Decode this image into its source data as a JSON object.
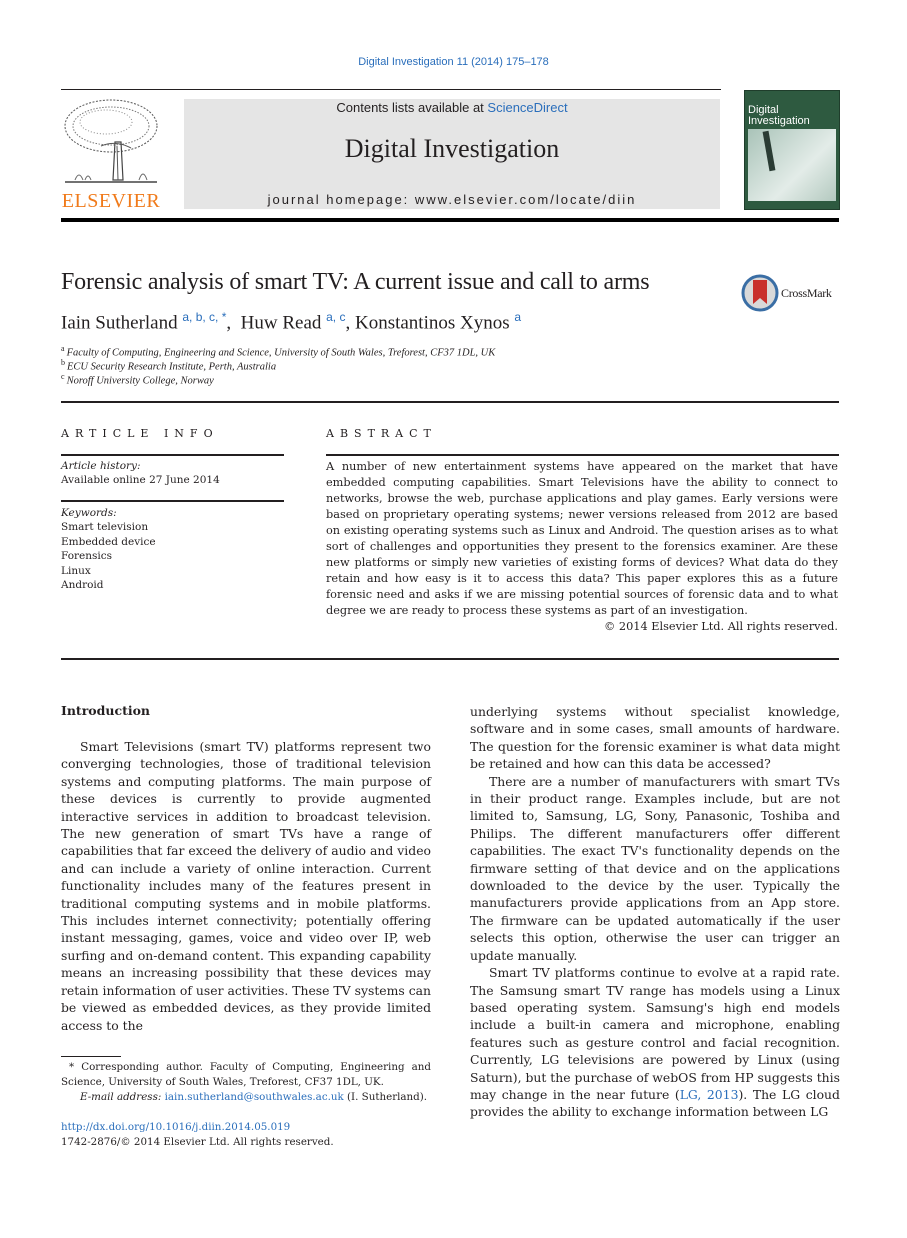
{
  "header": {
    "citation": "Digital Investigation 11 (2014) 175–178",
    "contents_prefix": "Contents lists available at ",
    "contents_link": "ScienceDirect",
    "journal_name": "Digital Investigation",
    "homepage": "journal homepage: www.elsevier.com/locate/diin",
    "publisher_logo": "ELSEVIER",
    "cover_title_line1": "Digital",
    "cover_title_line2": "Investigation"
  },
  "article": {
    "title": "Forensic analysis of smart TV: A current issue and call to arms",
    "crossmark": "CrossMark",
    "authors": [
      {
        "name": "Iain Sutherland",
        "sup": "a, b, c, *"
      },
      {
        "name": "Huw Read",
        "sup": "a, c"
      },
      {
        "name": "Konstantinos Xynos",
        "sup": "a"
      }
    ],
    "affiliations": [
      {
        "key": "a",
        "text": "Faculty of Computing, Engineering and Science, University of South Wales, Treforest, CF37 1DL, UK"
      },
      {
        "key": "b",
        "text": "ECU Security Research Institute, Perth, Australia"
      },
      {
        "key": "c",
        "text": "Noroff University College, Norway"
      }
    ]
  },
  "article_info": {
    "heading": "ARTICLE INFO",
    "history_label": "Article history:",
    "history_value": "Available online 27 June 2014",
    "keywords_label": "Keywords:",
    "keywords": [
      "Smart television",
      "Embedded device",
      "Forensics",
      "Linux",
      "Android"
    ]
  },
  "abstract": {
    "heading": "ABSTRACT",
    "text": "A number of new entertainment systems have appeared on the market that have embedded computing capabilities. Smart Televisions have the ability to connect to networks, browse the web, purchase applications and play games. Early versions were based on proprietary operating systems; newer versions released from 2012 are based on existing operating systems such as Linux and Android. The question arises as to what sort of challenges and opportunities they present to the forensics examiner. Are these new platforms or simply new varieties of existing forms of devices? What data do they retain and how easy is it to access this data? This paper explores this as a future forensic need and asks if we are missing potential sources of forensic data and to what degree we are ready to process these systems as part of an investigation.",
    "copyright": "© 2014 Elsevier Ltd. All rights reserved."
  },
  "body": {
    "intro_heading": "Introduction",
    "left_para1": "Smart Televisions (smart TV) platforms represent two converging technologies, those of traditional television systems and computing platforms. The main purpose of these devices is currently to provide augmented interactive services in addition to broadcast television. The new generation of smart TVs have a range of capabilities that far exceed the delivery of audio and video and can include a variety of online interaction. Current functionality includes many of the features present in traditional computing systems and in mobile platforms. This includes internet connectivity; potentially offering instant messaging, games, voice and video over IP, web surfing and on-demand content. This expanding capability means an increasing possibility that these devices may retain information of user activities. These TV systems can be viewed as embedded devices, as they provide limited access to the",
    "right_para0": "underlying systems without specialist knowledge, software and in some cases, small amounts of hardware. The question for the forensic examiner is what data might be retained and how can this data be accessed?",
    "right_para1": "There are a number of manufacturers with smart TVs in their product range. Examples include, but are not limited to, Samsung, LG, Sony, Panasonic, Toshiba and Philips. The different manufacturers offer different capabilities. The exact TV's functionality depends on the firmware setting of that device and on the applications downloaded to the device by the user. Typically the manufacturers provide applications from an App store. The firmware can be updated automatically if the user selects this option, otherwise the user can trigger an update manually.",
    "right_para2_a": "Smart TV platforms continue to evolve at a rapid rate. The Samsung smart TV range has models using a Linux based operating system. Samsung's high end models include a built-in camera and microphone, enabling features such as gesture control and facial recognition. Currently, LG televisions are powered by Linux (using Saturn), but the purchase of webOS from HP suggests this may change in the near future (",
    "right_para2_link": "LG, 2013",
    "right_para2_b": "). The LG cloud provides the ability to exchange information between LG"
  },
  "footnote": {
    "marker": "*",
    "text": "Corresponding author. Faculty of Computing, Engineering and Science, University of South Wales, Treforest, CF37 1DL, UK.",
    "email_label": "E-mail address:",
    "email": "iain.sutherland@southwales.ac.uk",
    "email_suffix": "(I. Sutherland).",
    "doi": "http://dx.doi.org/10.1016/j.diin.2014.05.019",
    "issn": "1742-2876/© 2014 Elsevier Ltd. All rights reserved."
  },
  "colors": {
    "link": "#2a6ebb",
    "elsevier_orange": "#f07a1a",
    "masthead_bg": "#e5e5e5",
    "cover_green": "#2e5a40"
  }
}
